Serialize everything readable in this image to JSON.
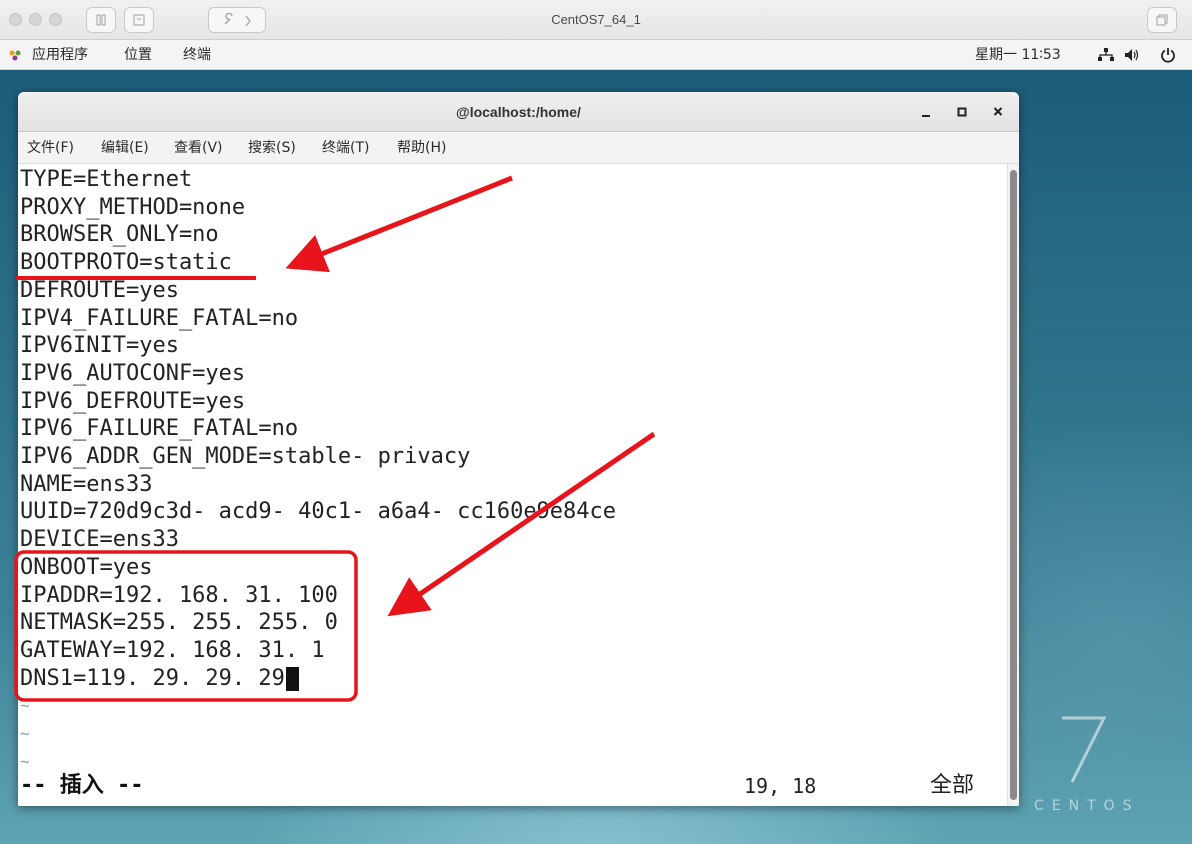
{
  "host": {
    "title": "CentOS7_64_1"
  },
  "topbar": {
    "apps": "应用程序",
    "places": "位置",
    "terminal": "终端",
    "clock": "星期一 11∶53"
  },
  "terminal": {
    "title": "@localhost:/home/",
    "menu": [
      "文件(F)",
      "编辑(E)",
      "查看(V)",
      "搜索(S)",
      "终端(T)",
      "帮助(H)"
    ],
    "lines": [
      "TYPE=Ethernet",
      "PROXY_METHOD=none",
      "BROWSER_ONLY=no",
      "BOOTPROTO=static",
      "DEFROUTE=yes",
      "IPV4_FAILURE_FATAL=no",
      "IPV6INIT=yes",
      "IPV6_AUTOCONF=yes",
      "IPV6_DEFROUTE=yes",
      "IPV6_FAILURE_FATAL=no",
      "IPV6_ADDR_GEN_MODE=stable- privacy",
      "NAME=ens33",
      "UUID=720d9c3d- acd9- 40c1- a6a4- cc160e9e84ce",
      "DEVICE=ens33",
      "ONBOOT=yes",
      "IPADDR=192. 168. 31. 100",
      "NETMASK=255. 255. 255. 0",
      "GATEWAY=192. 168. 31. 1",
      "DNS1=119. 29. 29. 29"
    ],
    "tilde": "~",
    "status_mode": "-- 插入 --",
    "status_position": "19, 18",
    "status_all": "全部"
  },
  "desktop": {
    "brand_word": "CENTOS"
  },
  "colors": {
    "annotation": "#e8141c"
  }
}
